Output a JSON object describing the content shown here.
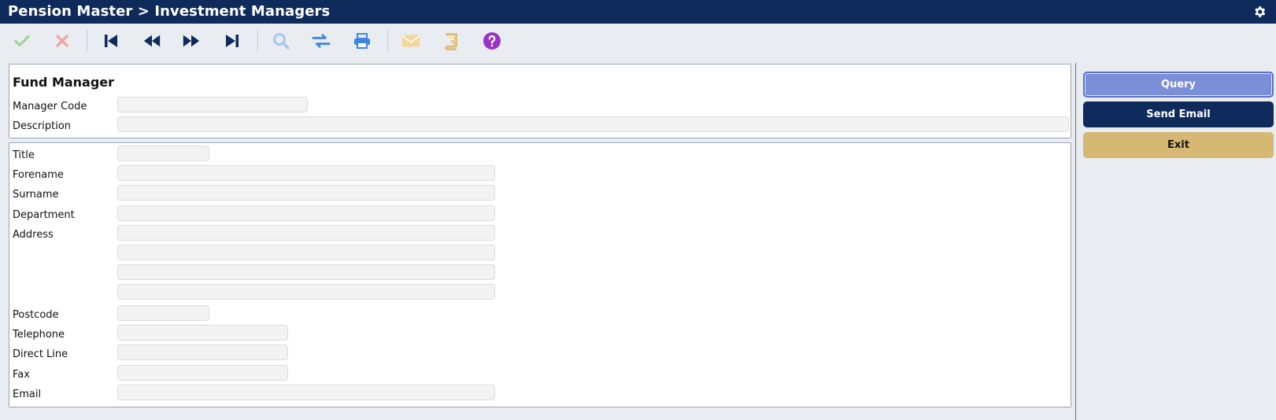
{
  "window": {
    "title": "Pension Master > Investment Managers"
  },
  "toolbar": {
    "icons": [
      "check-icon",
      "cancel-icon",
      "first-record-icon",
      "previous-record-icon",
      "next-record-icon",
      "last-record-icon",
      "search-icon",
      "swap-icon",
      "print-icon",
      "email-icon",
      "book-icon",
      "help-icon"
    ]
  },
  "fund_manager": {
    "heading": "Fund Manager",
    "manager_code_label": "Manager Code",
    "manager_code_value": "",
    "description_label": "Description",
    "description_value": ""
  },
  "details": {
    "title_label": "Title",
    "forename_label": "Forename",
    "surname_label": "Surname",
    "department_label": "Department",
    "address_label": "Address",
    "postcode_label": "Postcode",
    "telephone_label": "Telephone",
    "direct_line_label": "Direct Line",
    "fax_label": "Fax",
    "email_label": "Email"
  },
  "actions": {
    "query": "Query",
    "send_email": "Send Email",
    "exit": "Exit"
  },
  "colors": {
    "header_bg": "#0f2b5c",
    "query_bg": "#7b8fd9",
    "send_email_bg": "#0f2b5c",
    "exit_bg": "#d4b873"
  }
}
